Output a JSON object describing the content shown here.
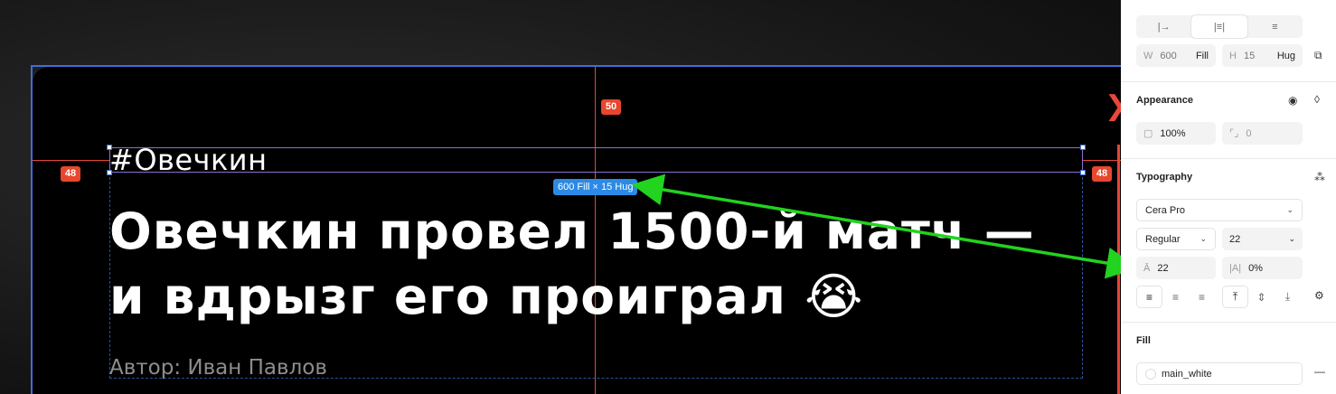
{
  "canvas": {
    "badges": {
      "top": "50",
      "left": "48",
      "right": "48"
    },
    "size_tag": "600 Fill × 15 Hug",
    "hashtag": "#Овечкин",
    "headline_line1": "Овечкин провел 1500-й матч —",
    "headline_line2": "и вдрызг его проиграл 😭",
    "author": "Автор: Иван Павлов"
  },
  "panel": {
    "layout": {
      "tabs": [
        "|→",
        "|≡|",
        "≡"
      ],
      "active_tab": 1,
      "width_label": "W",
      "width_value": "600",
      "width_mode": "Fill",
      "height_label": "H",
      "height_value": "15",
      "height_mode": "Hug"
    },
    "appearance": {
      "title": "Appearance",
      "opacity": "100%",
      "radius": "0"
    },
    "typography": {
      "title": "Typography",
      "font_family": "Cera Pro",
      "font_weight": "Regular",
      "font_size": "22",
      "line_height": "22",
      "letter_spacing": "0%"
    },
    "fill": {
      "title": "Fill",
      "style_name": "main_white"
    }
  },
  "colors": {
    "accent_red": "#e8473a",
    "selection_blue": "#3d6fd6",
    "arrow_green": "#22d31f",
    "tag_blue": "#2b8ae5"
  }
}
